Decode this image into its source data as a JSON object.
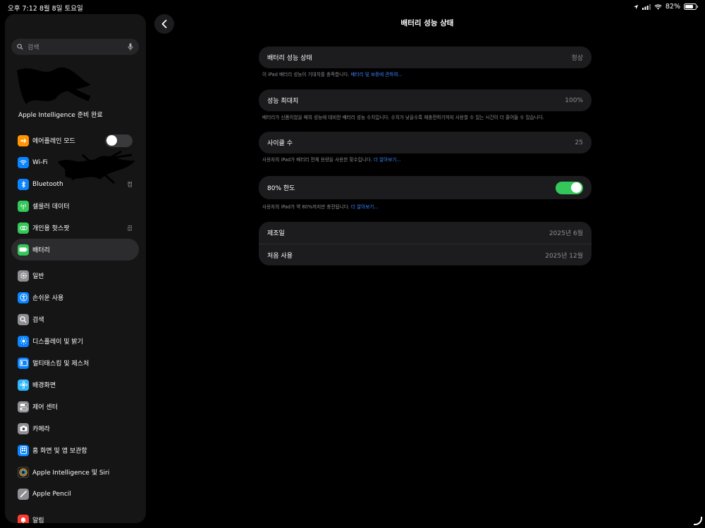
{
  "status_bar": {
    "time_date": "오후 7:12   8월 8일 토요일",
    "battery_percent": "82%",
    "battery_level": 0.82
  },
  "sidebar": {
    "search_placeholder": "검색",
    "apple_intelligence_status": "Apple Intelligence 준비 완료",
    "items": [
      {
        "name": "airplane-mode",
        "label": "에어플레인 모드",
        "icon": "airplane-icon",
        "color": "#ff9500",
        "toggle": "off"
      },
      {
        "name": "wifi",
        "label": "Wi-Fi",
        "icon": "wifi-icon",
        "color": "#0a84ff"
      },
      {
        "name": "bluetooth",
        "label": "Bluetooth",
        "value": "켬",
        "icon": "bluetooth-icon",
        "color": "#0a84ff"
      },
      {
        "name": "cellular",
        "label": "셀룰러 데이터",
        "icon": "antenna-icon",
        "color": "#34c759"
      },
      {
        "name": "hotspot",
        "label": "개인용 핫스팟",
        "value": "끔",
        "icon": "link-icon",
        "color": "#34c759"
      },
      {
        "name": "battery",
        "label": "배터리",
        "icon": "battery-icon",
        "color": "#34c759",
        "active": true
      },
      {
        "name": "general",
        "label": "일반",
        "icon": "gear-icon",
        "color": "#8e8e93"
      },
      {
        "name": "accessibility",
        "label": "손쉬운 사용",
        "icon": "accessibility-icon",
        "color": "#0a84ff"
      },
      {
        "name": "search",
        "label": "검색",
        "icon": "magnifier-icon",
        "color": "#8e8e93"
      },
      {
        "name": "display",
        "label": "디스플레이 및 밝기",
        "icon": "sun-icon",
        "color": "#0a84ff"
      },
      {
        "name": "multitasking",
        "label": "멀티태스킹 및 제스처",
        "icon": "multitasking-icon",
        "color": "#0a84ff"
      },
      {
        "name": "wallpaper",
        "label": "배경화면",
        "icon": "flower-icon",
        "color": "#2fb6ff"
      },
      {
        "name": "control-center",
        "label": "제어 센터",
        "icon": "switches-icon",
        "color": "#8e8e93"
      },
      {
        "name": "camera",
        "label": "카메라",
        "icon": "camera-icon",
        "color": "#8e8e93"
      },
      {
        "name": "home-screen",
        "label": "홈 화면 및 앱 보관함",
        "icon": "home-screen-icon",
        "color": "#0a84ff"
      },
      {
        "name": "siri",
        "label": "Apple Intelligence 및 Siri",
        "icon": "siri-icon",
        "color": "#bf5af2"
      },
      {
        "name": "apple-pencil",
        "label": "Apple Pencil",
        "icon": "pencil-icon",
        "color": "#8e8e93"
      },
      {
        "name": "notifications",
        "label": "알림",
        "icon": "bell-icon",
        "color": "#ff3b30"
      }
    ]
  },
  "main": {
    "title": "배터리 성능 상태",
    "battery_health": {
      "label": "배터리 성능 상태",
      "value": "정상"
    },
    "battery_health_note": "이 iPad 배터리 성능이 기대치를 충족합니다. ",
    "battery_health_link": "배터리 및 보증에 관하여...",
    "max_capacity": {
      "label": "성능 최대치",
      "value": "100%"
    },
    "max_capacity_note": "배터리가 신품이었을 때의 성능에 대비한 배터리 성능 수치입니다. 수치가 낮을수록 재충전하기까지 사용할 수 있는 시간이 더 줄어들 수 있습니다.",
    "cycle_count": {
      "label": "사이클 수",
      "value": "25"
    },
    "cycle_count_note": "사용자의 iPad가 배터리 전체 용량을 사용한 횟수입니다. ",
    "cycle_count_link": "더 알아보기...",
    "limit_80": {
      "label": "80% 한도",
      "toggle": "on"
    },
    "limit_80_note": "사용자의 iPad가 약 80%까지만 충전됩니다. ",
    "limit_80_link": "더 알아보기...",
    "manufacture_date": {
      "label": "제조일",
      "value": "2025년 6월"
    },
    "first_use": {
      "label": "처음 사용",
      "value": "2025년 12월"
    }
  }
}
